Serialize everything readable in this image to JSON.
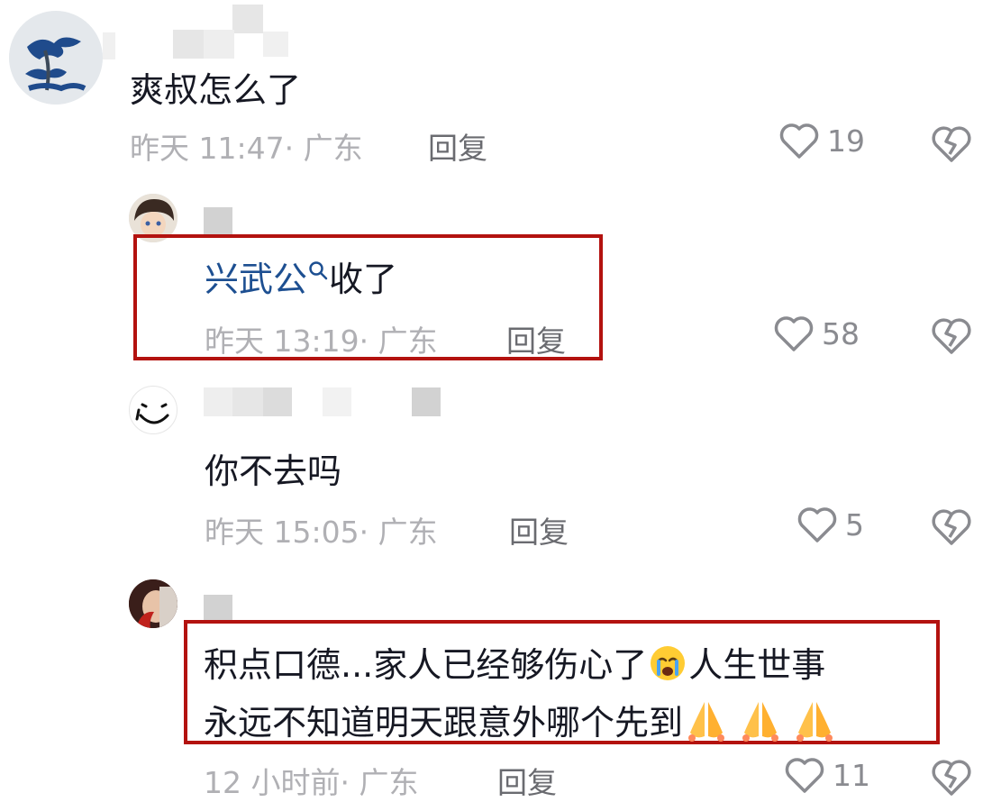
{
  "comments": [
    {
      "text": "爽叔怎么了",
      "time": "昨天 11:47",
      "location": "广东",
      "reply_label": "回复",
      "likes": "19"
    },
    {
      "mention": "兴武公",
      "text": "收了",
      "time": "昨天 13:19",
      "location": "广东",
      "reply_label": "回复",
      "likes": "58"
    },
    {
      "text": "你不去吗",
      "time": "昨天 15:05",
      "location": "广东",
      "reply_label": "回复",
      "likes": "5"
    },
    {
      "line1": "积点口德...家人已经够伤心了",
      "line1b": "人生世事",
      "line2": "永远不知道明天跟意外哪个先到",
      "time": "12 小时前",
      "location": "广东",
      "reply_label": "回复",
      "likes": "11"
    }
  ],
  "colors": {
    "highlight_box": "#b3120f",
    "mention": "#1d4f91",
    "meta_text": "#b0b0b4"
  },
  "icons": [
    "heart-outline-icon",
    "broken-heart-icon",
    "search-icon",
    "crying-face-emoji",
    "praying-hands-emoji"
  ]
}
